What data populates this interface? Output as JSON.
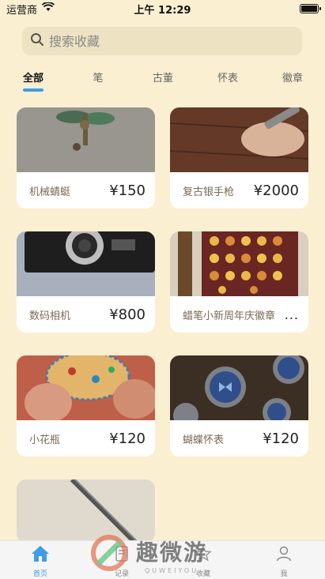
{
  "status": {
    "carrier": "运营商",
    "time": "上午 12:29"
  },
  "search": {
    "placeholder": "搜索收藏"
  },
  "tabs": [
    "全部",
    "笔",
    "古董",
    "怀表",
    "徽章"
  ],
  "items": [
    {
      "name": "机械蜻蜓",
      "price": "¥150"
    },
    {
      "name": "复古银手枪",
      "price": "¥2000"
    },
    {
      "name": "数码相机",
      "price": "¥800"
    },
    {
      "name": "蜡笔小新周年庆徽章",
      "price": "..."
    },
    {
      "name": "小花瓶",
      "price": "¥120"
    },
    {
      "name": "蝴蝶怀表",
      "price": "¥120"
    }
  ],
  "nav": [
    "首页",
    "记录",
    "收藏",
    "我"
  ],
  "watermark": {
    "title": "趣微游",
    "subtitle": "QUWEIYOU"
  },
  "colors": {
    "background": "#fbefd2",
    "accent": "#3f9de6"
  }
}
